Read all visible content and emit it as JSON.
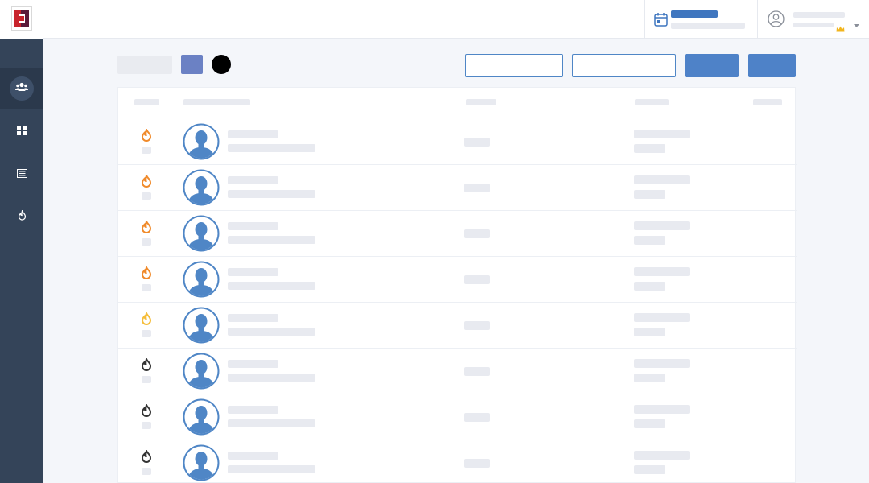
{
  "app": {
    "logo_icon": "brand-logo-icon",
    "logo_colors": [
      "#c8232c",
      "#5a1a3a"
    ]
  },
  "sidebar": {
    "items": [
      {
        "icon": "users-icon",
        "active": true
      },
      {
        "icon": "dashboard-grid-icon",
        "active": false
      },
      {
        "icon": "list-icon",
        "active": false
      },
      {
        "icon": "fire-icon",
        "active": false
      }
    ]
  },
  "header": {
    "date_icon": "calendar-icon",
    "user_icon": "user-circle-icon",
    "crown_icon": "crown-icon",
    "dropdown_icon": "chevron-down-icon"
  },
  "toolbar": {
    "swatch_color": "#6b81c4",
    "dot_color": "#000000",
    "accent_color": "#4e82c8"
  },
  "table": {
    "rows": [
      {
        "status": "hot",
        "fire_color": "#f08a2a"
      },
      {
        "status": "hot",
        "fire_color": "#f08a2a"
      },
      {
        "status": "hot",
        "fire_color": "#f08a2a"
      },
      {
        "status": "hot",
        "fire_color": "#f08a2a"
      },
      {
        "status": "warm",
        "fire_color": "#f5bd3a"
      },
      {
        "status": "cold",
        "fire_color": "#333333"
      },
      {
        "status": "cold",
        "fire_color": "#333333"
      },
      {
        "status": "cold",
        "fire_color": "#333333"
      }
    ]
  }
}
